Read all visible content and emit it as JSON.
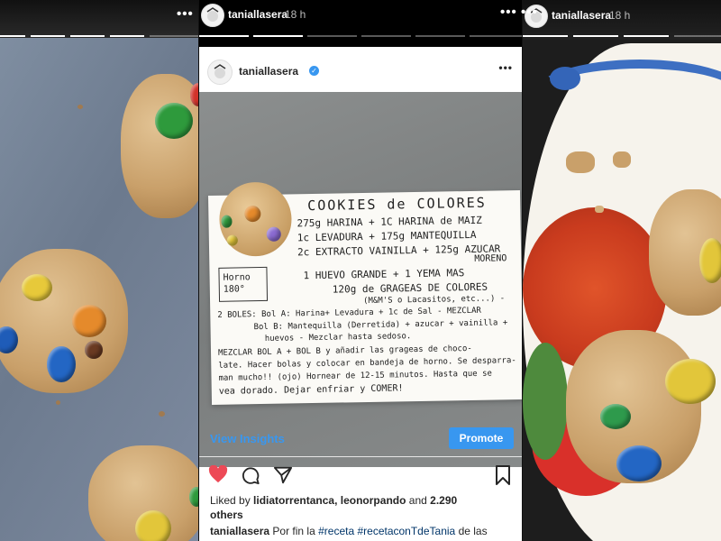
{
  "left_story": {
    "image": "cookie-photo"
  },
  "center_story": {
    "username": "taniallasera",
    "time": "18 h",
    "more": "•••",
    "post": {
      "username": "taniallasera",
      "more": "•••",
      "view_insights": "View Insights",
      "promote": "Promote",
      "likes": {
        "prefix": "Liked by",
        "user1": "lidiatorrentanca",
        "user2": "leonorpando",
        "and": "and",
        "count": "2.290",
        "others": "others"
      },
      "caption": {
        "username": "taniallasera",
        "text1": "Por fin la",
        "tag1": "#receta",
        "tag2": "#recetaconTdeTania",
        "text2": "de las"
      },
      "recipe": {
        "title": "COOKIES de COLORES",
        "lines": [
          "275g HARINA + 1C HARINA de MAIZ",
          "1c LEVADURA + 175g MANTEQUILLA",
          "2c EXTRACTO VAINILLA + 125g AZUCAR",
          "MORENO",
          "1 HUEVO GRANDE + 1 YEMA MAS",
          "120g de GRAGEAS DE COLORES",
          "(M&M'S o Lacasitos, etc...) -"
        ],
        "oven": "Horno 180°",
        "bowls": [
          "2 BOLES: Bol A: Harina+ Levadura + 1c de Sal - MEZCLAR",
          "Bol B: Mantequilla (Derretida) + azucar + vainilla +",
          "huevos - Mezclar hasta sedoso.",
          "MEZCLAR BOL A + BOL B y añadir las grageas de choco-",
          "late. Hacer bolas y colocar en bandeja de horno. Se desparra-",
          "man mucho!! (ojo) Hornear de 12-15 minutos. Hasta que se",
          "vea dorado. Dejar enfriar y COMER!"
        ]
      }
    }
  },
  "right_story": {
    "username": "taniallasera",
    "time": "18 h",
    "more": "•••"
  },
  "colors": {
    "accent": "#3897f0",
    "like": "#ed4956"
  }
}
